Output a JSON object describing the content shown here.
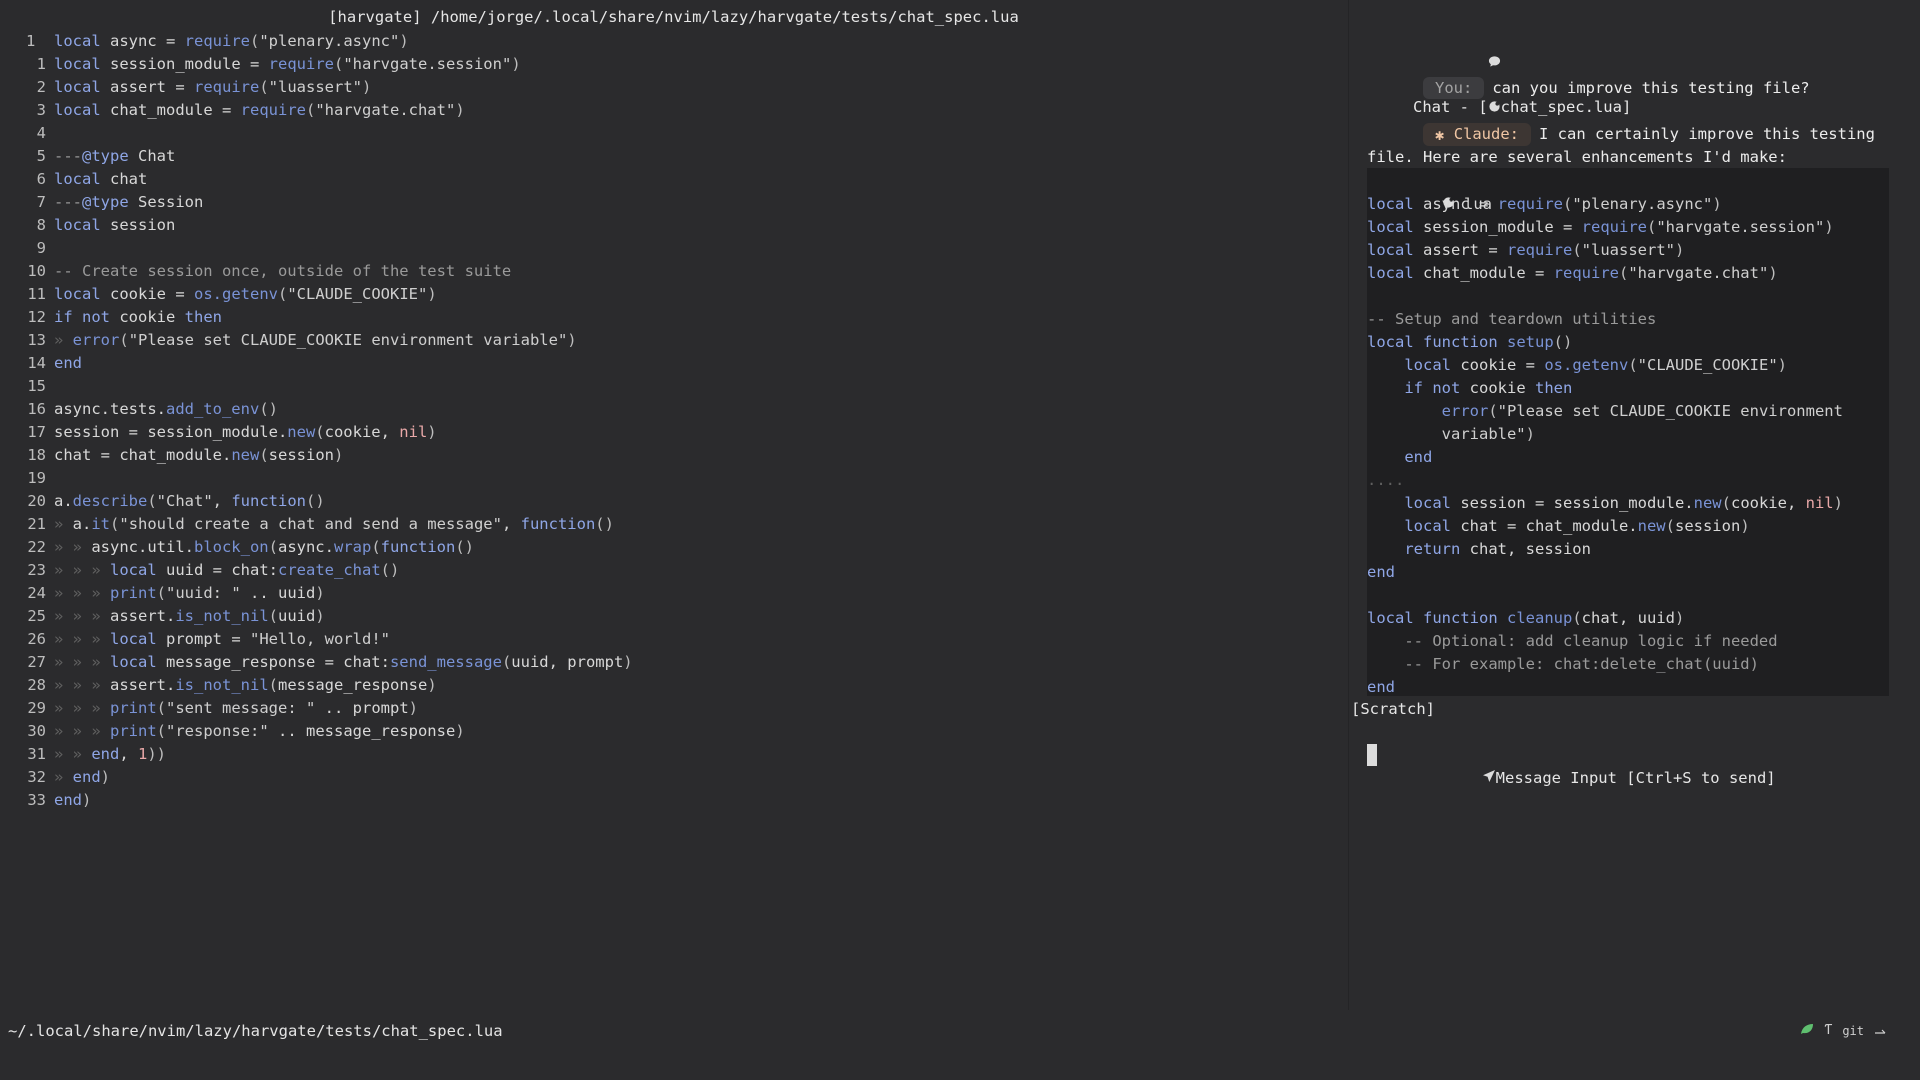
{
  "editor": {
    "winbar": "[harvgate] /home/jorge/.local/share/nvim/lazy/harvgate/tests/chat_spec.lua",
    "lines": [
      {
        "n": "1",
        "tokens": [
          [
            "kw",
            "local"
          ],
          [
            "src",
            " async = "
          ],
          [
            "fn",
            "require"
          ],
          [
            "par",
            "("
          ],
          [
            "str",
            "\"plenary.async\""
          ],
          [
            "par",
            ")"
          ]
        ]
      },
      {
        "n": "1",
        "tokens": [
          [
            "kw",
            "local"
          ],
          [
            "src",
            " session_module = "
          ],
          [
            "fn",
            "require"
          ],
          [
            "par",
            "("
          ],
          [
            "str",
            "\"harvgate.session\""
          ],
          [
            "par",
            ")"
          ]
        ]
      },
      {
        "n": "2",
        "tokens": [
          [
            "kw",
            "local"
          ],
          [
            "src",
            " assert = "
          ],
          [
            "fn",
            "require"
          ],
          [
            "par",
            "("
          ],
          [
            "str",
            "\"luassert\""
          ],
          [
            "par",
            ")"
          ]
        ]
      },
      {
        "n": "3",
        "tokens": [
          [
            "kw",
            "local"
          ],
          [
            "src",
            " chat_module = "
          ],
          [
            "fn",
            "require"
          ],
          [
            "par",
            "("
          ],
          [
            "str",
            "\"harvgate.chat\""
          ],
          [
            "par",
            ")"
          ]
        ]
      },
      {
        "n": "4",
        "tokens": []
      },
      {
        "n": "5",
        "tokens": [
          [
            "cmt",
            "---"
          ],
          [
            "ann",
            "@type"
          ],
          [
            "src",
            " Chat"
          ]
        ]
      },
      {
        "n": "6",
        "tokens": [
          [
            "kw",
            "local"
          ],
          [
            "src",
            " chat"
          ]
        ]
      },
      {
        "n": "7",
        "tokens": [
          [
            "cmt",
            "---"
          ],
          [
            "ann",
            "@type"
          ],
          [
            "src",
            " Session"
          ]
        ]
      },
      {
        "n": "8",
        "tokens": [
          [
            "kw",
            "local"
          ],
          [
            "src",
            " session"
          ]
        ]
      },
      {
        "n": "9",
        "tokens": []
      },
      {
        "n": "10",
        "tokens": [
          [
            "cmt",
            "-- Create session once, outside of the test suite"
          ]
        ]
      },
      {
        "n": "11",
        "tokens": [
          [
            "kw",
            "local"
          ],
          [
            "src",
            " cookie = "
          ],
          [
            "fn",
            "os.getenv"
          ],
          [
            "par",
            "("
          ],
          [
            "str",
            "\"CLAUDE_COOKIE\""
          ],
          [
            "par",
            ")"
          ]
        ]
      },
      {
        "n": "12",
        "tokens": [
          [
            "kw",
            "if not"
          ],
          [
            "src",
            " cookie "
          ],
          [
            "kw",
            "then"
          ]
        ]
      },
      {
        "n": "13",
        "tokens": [
          [
            "ind",
            "» "
          ],
          [
            "fn",
            "error"
          ],
          [
            "par",
            "("
          ],
          [
            "str",
            "\"Please set CLAUDE_COOKIE environment variable\""
          ],
          [
            "par",
            ")"
          ]
        ]
      },
      {
        "n": "14",
        "tokens": [
          [
            "kw",
            "end"
          ]
        ]
      },
      {
        "n": "15",
        "tokens": []
      },
      {
        "n": "16",
        "tokens": [
          [
            "src",
            "async.tests."
          ],
          [
            "fn",
            "add_to_env"
          ],
          [
            "par",
            "()"
          ]
        ]
      },
      {
        "n": "17",
        "tokens": [
          [
            "src",
            "session = session_module."
          ],
          [
            "fn",
            "new"
          ],
          [
            "par",
            "("
          ],
          [
            "src",
            "cookie, "
          ],
          [
            "num",
            "nil"
          ],
          [
            "par",
            ")"
          ]
        ]
      },
      {
        "n": "18",
        "tokens": [
          [
            "src",
            "chat = chat_module."
          ],
          [
            "fn",
            "new"
          ],
          [
            "par",
            "("
          ],
          [
            "src",
            "session"
          ],
          [
            "par",
            ")"
          ]
        ]
      },
      {
        "n": "19",
        "tokens": []
      },
      {
        "n": "20",
        "tokens": [
          [
            "src",
            "a."
          ],
          [
            "fn",
            "describe"
          ],
          [
            "par",
            "("
          ],
          [
            "str",
            "\"Chat\""
          ],
          [
            "src",
            ", "
          ],
          [
            "kw",
            "function"
          ],
          [
            "par",
            "()"
          ]
        ]
      },
      {
        "n": "21",
        "tokens": [
          [
            "ind",
            "» "
          ],
          [
            "src",
            "a."
          ],
          [
            "fn",
            "it"
          ],
          [
            "par",
            "("
          ],
          [
            "str",
            "\"should create a chat and send a message\""
          ],
          [
            "src",
            ", "
          ],
          [
            "kw",
            "function"
          ],
          [
            "par",
            "()"
          ]
        ]
      },
      {
        "n": "22",
        "tokens": [
          [
            "ind",
            "» » "
          ],
          [
            "src",
            "async.util."
          ],
          [
            "fn",
            "block_on"
          ],
          [
            "par",
            "("
          ],
          [
            "src",
            "async."
          ],
          [
            "fn",
            "wrap"
          ],
          [
            "par",
            "("
          ],
          [
            "kw",
            "function"
          ],
          [
            "par",
            "()"
          ]
        ]
      },
      {
        "n": "23",
        "tokens": [
          [
            "ind",
            "» » » "
          ],
          [
            "kw",
            "local"
          ],
          [
            "src",
            " uuid = chat:"
          ],
          [
            "fn",
            "create_chat"
          ],
          [
            "par",
            "()"
          ]
        ]
      },
      {
        "n": "24",
        "tokens": [
          [
            "ind",
            "» » » "
          ],
          [
            "fn",
            "print"
          ],
          [
            "par",
            "("
          ],
          [
            "str",
            "\"uuid: \""
          ],
          [
            "src",
            " .. uuid"
          ],
          [
            "par",
            ")"
          ]
        ]
      },
      {
        "n": "25",
        "tokens": [
          [
            "ind",
            "» » » "
          ],
          [
            "src",
            "assert."
          ],
          [
            "fn",
            "is_not_nil"
          ],
          [
            "par",
            "("
          ],
          [
            "src",
            "uuid"
          ],
          [
            "par",
            ")"
          ]
        ]
      },
      {
        "n": "26",
        "tokens": [
          [
            "ind",
            "» » » "
          ],
          [
            "kw",
            "local"
          ],
          [
            "src",
            " prompt = "
          ],
          [
            "str",
            "\"Hello, world!\""
          ]
        ]
      },
      {
        "n": "27",
        "tokens": [
          [
            "ind",
            "» » » "
          ],
          [
            "kw",
            "local"
          ],
          [
            "src",
            " message_response = chat:"
          ],
          [
            "fn",
            "send_message"
          ],
          [
            "par",
            "("
          ],
          [
            "src",
            "uuid, prompt"
          ],
          [
            "par",
            ")"
          ]
        ]
      },
      {
        "n": "28",
        "tokens": [
          [
            "ind",
            "» » » "
          ],
          [
            "src",
            "assert."
          ],
          [
            "fn",
            "is_not_nil"
          ],
          [
            "par",
            "("
          ],
          [
            "src",
            "message_response"
          ],
          [
            "par",
            ")"
          ]
        ]
      },
      {
        "n": "29",
        "tokens": [
          [
            "ind",
            "» » » "
          ],
          [
            "fn",
            "print"
          ],
          [
            "par",
            "("
          ],
          [
            "str",
            "\"sent message: \""
          ],
          [
            "src",
            " .. prompt"
          ],
          [
            "par",
            ")"
          ]
        ]
      },
      {
        "n": "30",
        "tokens": [
          [
            "ind",
            "» » » "
          ],
          [
            "fn",
            "print"
          ],
          [
            "par",
            "("
          ],
          [
            "str",
            "\"response:\""
          ],
          [
            "src",
            " .. message_response"
          ],
          [
            "par",
            ")"
          ]
        ]
      },
      {
        "n": "31",
        "tokens": [
          [
            "ind",
            "» » "
          ],
          [
            "kw",
            "end"
          ],
          [
            "src",
            ", "
          ],
          [
            "num",
            "1"
          ],
          [
            "par",
            "))"
          ]
        ]
      },
      {
        "n": "32",
        "tokens": [
          [
            "ind",
            "» "
          ],
          [
            "kw",
            "end"
          ],
          [
            "par",
            ")"
          ]
        ]
      },
      {
        "n": "33",
        "tokens": [
          [
            "kw",
            "end"
          ],
          [
            "par",
            ")"
          ]
        ]
      }
    ]
  },
  "chat": {
    "title": "Chat - [",
    "title_file": "chat_spec.lua]",
    "you_label": "You:",
    "you_text": "can you improve this testing file?",
    "claude_label": "Claude:",
    "claude_text_1": "I can certainly improve this testing file.",
    "claude_text_2": "Here are several enhancements I'd make:",
    "code_lang": "lua",
    "code_lines": [
      [
        [
          "kw",
          "local"
        ],
        [
          "src",
          " async = "
        ],
        [
          "fn",
          "require"
        ],
        [
          "par",
          "("
        ],
        [
          "str",
          "\"plenary.async\""
        ],
        [
          "par",
          ")"
        ]
      ],
      [
        [
          "kw",
          "local"
        ],
        [
          "src",
          " session_module = "
        ],
        [
          "fn",
          "require"
        ],
        [
          "par",
          "("
        ],
        [
          "str",
          "\"harvgate.session\""
        ],
        [
          "par",
          ")"
        ]
      ],
      [
        [
          "kw",
          "local"
        ],
        [
          "src",
          " assert = "
        ],
        [
          "fn",
          "require"
        ],
        [
          "par",
          "("
        ],
        [
          "str",
          "\"luassert\""
        ],
        [
          "par",
          ")"
        ]
      ],
      [
        [
          "kw",
          "local"
        ],
        [
          "src",
          " chat_module = "
        ],
        [
          "fn",
          "require"
        ],
        [
          "par",
          "("
        ],
        [
          "str",
          "\"harvgate.chat\""
        ],
        [
          "par",
          ")"
        ]
      ],
      [],
      [
        [
          "cmt",
          "-- Setup and teardown utilities"
        ]
      ],
      [
        [
          "kw",
          "local function"
        ],
        [
          "src",
          " "
        ],
        [
          "fn",
          "setup"
        ],
        [
          "par",
          "()"
        ]
      ],
      [
        [
          "src",
          "    "
        ],
        [
          "kw",
          "local"
        ],
        [
          "src",
          " cookie = "
        ],
        [
          "fn",
          "os.getenv"
        ],
        [
          "par",
          "("
        ],
        [
          "str",
          "\"CLAUDE_COOKIE\""
        ],
        [
          "par",
          ")"
        ]
      ],
      [
        [
          "src",
          "    "
        ],
        [
          "kw",
          "if not"
        ],
        [
          "src",
          " cookie "
        ],
        [
          "kw",
          "then"
        ]
      ],
      [
        [
          "src",
          "        "
        ],
        [
          "fn",
          "error"
        ],
        [
          "par",
          "("
        ],
        [
          "str",
          "\"Please set CLAUDE_COOKIE environment"
        ]
      ],
      [
        [
          "src",
          "        "
        ],
        [
          "str",
          "variable\""
        ],
        [
          "par",
          ")"
        ]
      ],
      [
        [
          "src",
          "    "
        ],
        [
          "kw",
          "end"
        ]
      ],
      [
        [
          "ind",
          "...."
        ]
      ],
      [
        [
          "src",
          "    "
        ],
        [
          "kw",
          "local"
        ],
        [
          "src",
          " session = session_module."
        ],
        [
          "fn",
          "new"
        ],
        [
          "par",
          "("
        ],
        [
          "src",
          "cookie, "
        ],
        [
          "num",
          "nil"
        ],
        [
          "par",
          ")"
        ]
      ],
      [
        [
          "src",
          "    "
        ],
        [
          "kw",
          "local"
        ],
        [
          "src",
          " chat = chat_module."
        ],
        [
          "fn",
          "new"
        ],
        [
          "par",
          "("
        ],
        [
          "src",
          "session"
        ],
        [
          "par",
          ")"
        ]
      ],
      [
        [
          "src",
          "    "
        ],
        [
          "kw",
          "return"
        ],
        [
          "src",
          " chat, session"
        ]
      ],
      [
        [
          "kw",
          "end"
        ]
      ],
      [],
      [
        [
          "kw",
          "local function"
        ],
        [
          "src",
          " "
        ],
        [
          "fn",
          "cleanup"
        ],
        [
          "par",
          "("
        ],
        [
          "src",
          "chat, uuid"
        ],
        [
          "par",
          ")"
        ]
      ],
      [
        [
          "src",
          "    "
        ],
        [
          "cmt",
          "-- Optional: add cleanup logic if needed"
        ]
      ],
      [
        [
          "src",
          "    "
        ],
        [
          "cmt",
          "-- For example: chat:delete_chat(uuid)"
        ]
      ],
      [
        [
          "kw",
          "end"
        ]
      ]
    ],
    "scratch": "[Scratch]",
    "input_hint": "Message Input [Ctrl+S to send]"
  },
  "status": {
    "path": "~/.local/share/nvim/lazy/harvgate/tests/chat_spec.lua",
    "git": "git"
  },
  "colors": {
    "background": "#2b2b2d",
    "keyword": "#8fa6e6",
    "claude_accent": "#f0c6a4",
    "status_leaf": "#5fbf6f"
  }
}
